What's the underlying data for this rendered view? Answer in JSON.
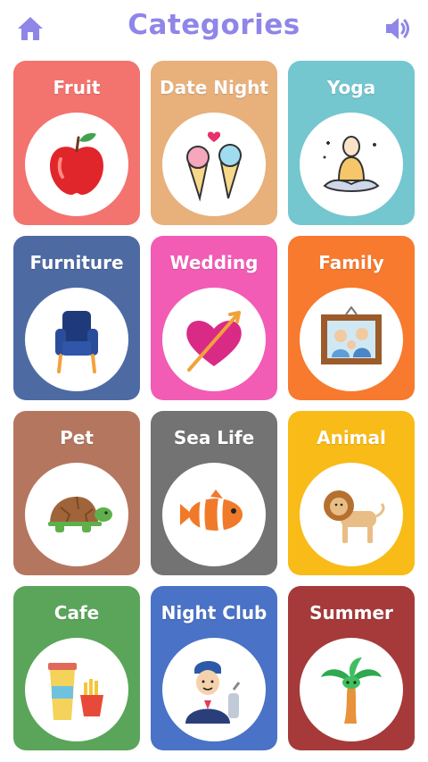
{
  "header": {
    "title": "Categories",
    "home_icon": "home-icon",
    "sound_icon": "speaker-icon"
  },
  "colors": {
    "title": "#8f86e8"
  },
  "categories": [
    {
      "label": "Fruit",
      "color": "#f3736e",
      "icon": "apple-icon"
    },
    {
      "label": "Date Night",
      "color": "#e8b07b",
      "icon": "ice-cream-icon"
    },
    {
      "label": "Yoga",
      "color": "#74c6cf",
      "icon": "meditation-icon"
    },
    {
      "label": "Furniture",
      "color": "#4e6aa3",
      "icon": "armchair-icon"
    },
    {
      "label": "Wedding",
      "color": "#f25cb5",
      "icon": "heart-arrow-icon"
    },
    {
      "label": "Family",
      "color": "#f77a2e",
      "icon": "family-photo-icon"
    },
    {
      "label": "Pet",
      "color": "#b57660",
      "icon": "turtle-icon"
    },
    {
      "label": "Sea Life",
      "color": "#737373",
      "icon": "clownfish-icon"
    },
    {
      "label": "Animal",
      "color": "#f8bb17",
      "icon": "lion-icon"
    },
    {
      "label": "Cafe",
      "color": "#5aa55a",
      "icon": "coffee-fries-icon"
    },
    {
      "label": "Night Club",
      "color": "#4a72c6",
      "icon": "bartender-icon"
    },
    {
      "label": "Summer",
      "color": "#a63a3a",
      "icon": "palm-tree-icon"
    }
  ]
}
